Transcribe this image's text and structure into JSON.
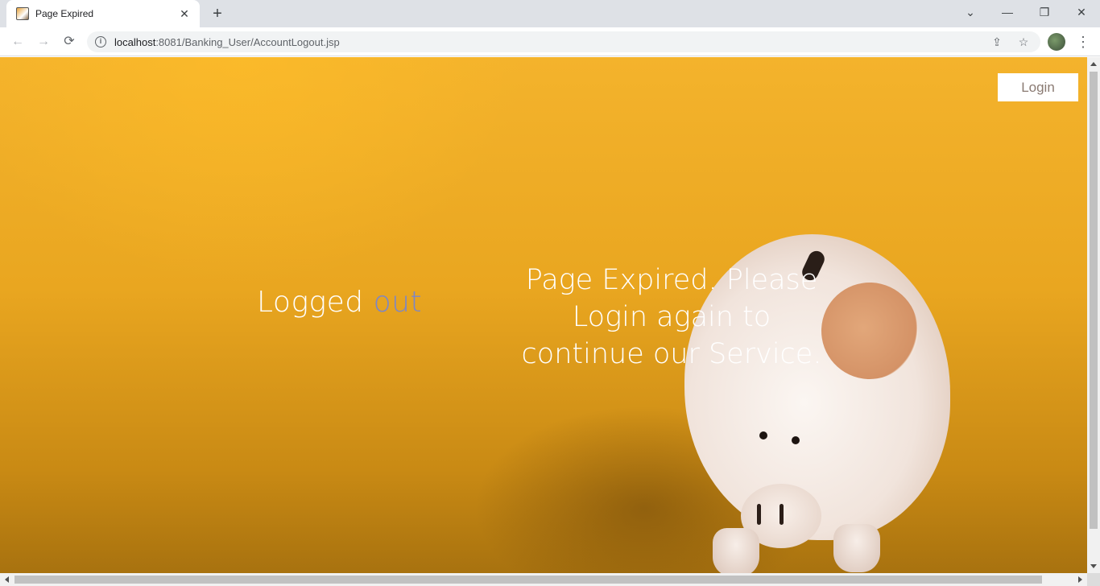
{
  "browser": {
    "tab_title": "Page Expired",
    "url_host": "localhost",
    "url_path": ":8081/Banking_User/AccountLogout.jsp",
    "icons": {
      "back": "←",
      "forward": "→",
      "reload": "⟳",
      "close": "✕",
      "new_tab": "+",
      "tab_search": "⌄",
      "minimize": "—",
      "restore": "❐",
      "window_close": "✕",
      "share": "⇪",
      "bookmark": "☆",
      "menu": "⋮",
      "info": "i"
    }
  },
  "page": {
    "logged_label": "Logged",
    "logged_accent": "out",
    "message": "Page Expired. Please Login again to continue our Service.",
    "login_button": "Login",
    "accent_color": "#7b86c9"
  }
}
